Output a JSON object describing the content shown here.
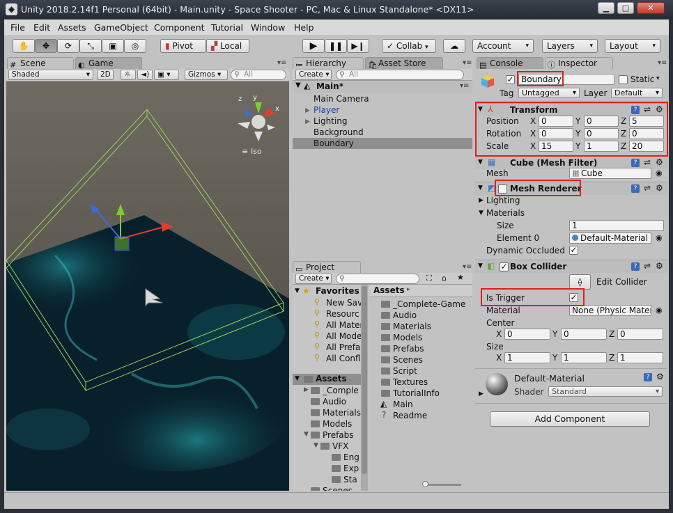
{
  "window": {
    "title": "Unity 2018.2.14f1 Personal (64bit) - Main.unity - Space Shooter - PC, Mac & Linux Standalone* <DX11>",
    "controls": [
      "minimize",
      "maximize",
      "close"
    ]
  },
  "menubar": [
    "File",
    "Edit",
    "Assets",
    "GameObject",
    "Component",
    "Tutorial",
    "Window",
    "Help"
  ],
  "toolbar": {
    "pivot": "Pivot",
    "local": "Local",
    "collab": "Collab",
    "account": "Account",
    "layers": "Layers",
    "layout": "Layout"
  },
  "scene": {
    "tabs": [
      "Scene",
      "Game"
    ],
    "shading": "Shaded",
    "mode_2d": "2D",
    "gizmos": "Gizmos",
    "search_placeholder": "All",
    "iso_label": "Iso",
    "axis_labels": {
      "x": "x",
      "y": "y",
      "z": "z"
    }
  },
  "hierarchy": {
    "tabs": [
      "Hierarchy",
      "Asset Store"
    ],
    "create": "Create",
    "search_placeholder": "All",
    "scene_name": "Main*",
    "items": [
      {
        "label": "Main Camera",
        "expandable": false,
        "selected": false,
        "prefab": false
      },
      {
        "label": "Player",
        "expandable": true,
        "selected": false,
        "prefab": true
      },
      {
        "label": "Lighting",
        "expandable": true,
        "selected": false,
        "prefab": false
      },
      {
        "label": "Background",
        "expandable": false,
        "selected": false,
        "prefab": false
      },
      {
        "label": "Boundary",
        "expandable": false,
        "selected": true,
        "prefab": false
      }
    ]
  },
  "project": {
    "tab": "Project",
    "create": "Create",
    "favorites_label": "Favorites",
    "favorites": [
      "New Sav",
      "Resourc",
      "All Mater",
      "All Mode",
      "All Prefa",
      "All Confl"
    ],
    "assets_label": "Assets",
    "tree": [
      "_Comple",
      "Audio",
      "Materials",
      "Models",
      "Prefabs",
      "VFX",
      "Eng",
      "Exp",
      "Sta",
      "Scenes"
    ],
    "breadcrumb": "Assets",
    "files": [
      {
        "label": "_Complete-Game",
        "kind": "folder"
      },
      {
        "label": "Audio",
        "kind": "folder"
      },
      {
        "label": "Materials",
        "kind": "folder"
      },
      {
        "label": "Models",
        "kind": "folder"
      },
      {
        "label": "Prefabs",
        "kind": "folder"
      },
      {
        "label": "Scenes",
        "kind": "folder"
      },
      {
        "label": "Script",
        "kind": "folder"
      },
      {
        "label": "Textures",
        "kind": "folder"
      },
      {
        "label": "TutorialInfo",
        "kind": "folder"
      },
      {
        "label": "Main",
        "kind": "unity-scene"
      },
      {
        "label": "Readme",
        "kind": "unknown"
      }
    ]
  },
  "inspector": {
    "tabs": [
      "Console",
      "Inspector"
    ],
    "object_name": "Boundary",
    "static_label": "Static",
    "tag_label": "Tag",
    "tag_value": "Untagged",
    "layer_label": "Layer",
    "layer_value": "Default",
    "transform": {
      "title": "Transform",
      "position_label": "Position",
      "position": [
        "0",
        "0",
        "5"
      ],
      "rotation_label": "Rotation",
      "rotation": [
        "0",
        "0",
        "0"
      ],
      "scale_label": "Scale",
      "scale": [
        "15",
        "1",
        "20"
      ],
      "axis": [
        "X",
        "Y",
        "Z"
      ]
    },
    "mesh_filter": {
      "title": "Cube (Mesh Filter)",
      "mesh_label": "Mesh",
      "mesh_value": "Cube"
    },
    "mesh_renderer": {
      "title": "Mesh Renderer",
      "enabled": false,
      "lighting_label": "Lighting",
      "materials_label": "Materials",
      "size_label": "Size",
      "size_value": "1",
      "element0_label": "Element 0",
      "element0_value": "Default-Material",
      "dynamic_occluded_label": "Dynamic Occluded",
      "dynamic_occluded": true
    },
    "box_collider": {
      "title": "Box Collider",
      "enabled": true,
      "edit_collider_label": "Edit Collider",
      "is_trigger_label": "Is Trigger",
      "is_trigger": true,
      "material_label": "Material",
      "material_value": "None (Physic Materi",
      "center_label": "Center",
      "center": [
        "0",
        "0",
        "0"
      ],
      "size_label": "Size",
      "size": [
        "1",
        "1",
        "1"
      ]
    },
    "material": {
      "name": "Default-Material",
      "shader_label": "Shader",
      "shader_value": "Standard"
    },
    "add_component": "Add Component"
  },
  "colors": {
    "highlight": "#e0201a",
    "prefab_blue": "#1c3fa8",
    "selection": "#8f8f8f",
    "title_bar": "#2f353e",
    "boundary_wire": "#9bd15c"
  }
}
